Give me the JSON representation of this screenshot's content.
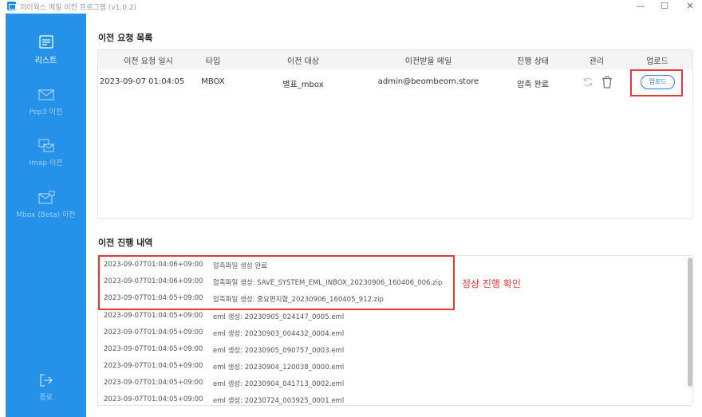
{
  "window": {
    "title": "하이웍스 메일 이전 프로그램 (v1.0.2)",
    "controls": {
      "minimize": "—",
      "maximize": "☐",
      "close": "✕"
    }
  },
  "sidebar": {
    "items": [
      {
        "label": "리스트",
        "icon": "list-icon",
        "active": true
      },
      {
        "label": "Pop3 이전",
        "icon": "mail-icon",
        "active": false
      },
      {
        "label": "Imap 이전",
        "icon": "mail-transfer-icon",
        "active": false
      },
      {
        "label": "Mbox (Beta) 이전",
        "icon": "mailbox-icon",
        "active": false
      }
    ],
    "exit": {
      "label": "종료",
      "icon": "logout-icon"
    }
  },
  "requests": {
    "title": "이전 요청 목록",
    "columns": [
      "이전 요청 일시",
      "타입",
      "이전 대상",
      "이전받을 메일",
      "진행 상태",
      "관리",
      "업로드"
    ],
    "rows": [
      {
        "date": "2023-09-07 01:04:05",
        "type": "MBOX",
        "target": "별표_mbox",
        "email": "admin@beombeom.store",
        "status": "압축 완료",
        "upload_label": "업로드"
      }
    ]
  },
  "progress": {
    "title": "이전 진행 내역",
    "logs": [
      {
        "ts": "2023-09-07T01:04:06+09:00",
        "msg": "압축파일 생성 완료"
      },
      {
        "ts": "2023-09-07T01:04:06+09:00",
        "msg": "압축파일 생성: SAVE_SYSTEM_EML_INBOX_20230906_160406_006.zip"
      },
      {
        "ts": "2023-09-07T01:04:05+09:00",
        "msg": "압축파일 생성: 중요편지함_20230906_160405_912.zip"
      },
      {
        "ts": "2023-09-07T01:04:05+09:00",
        "msg": "eml 생성: 20230905_024147_0005.eml"
      },
      {
        "ts": "2023-09-07T01:04:05+09:00",
        "msg": "eml 생성: 20230903_004432_0004.eml"
      },
      {
        "ts": "2023-09-07T01:04:05+09:00",
        "msg": "eml 생성: 20230905_090757_0003.eml"
      },
      {
        "ts": "2023-09-07T01:04:05+09:00",
        "msg": "eml 생성: 20230904_120038_0000.eml"
      },
      {
        "ts": "2023-09-07T01:04:05+09:00",
        "msg": "eml 생성: 20230904_041713_0002.eml"
      },
      {
        "ts": "2023-09-07T01:04:05+09:00",
        "msg": "eml 생성: 20230724_003925_0001.eml"
      }
    ]
  },
  "annotation": {
    "text": "정상 진행 확인",
    "color": "#e53935"
  },
  "colors": {
    "sidebar": "#2591e8",
    "accent": "#2b7de0",
    "highlight": "#e53935"
  }
}
